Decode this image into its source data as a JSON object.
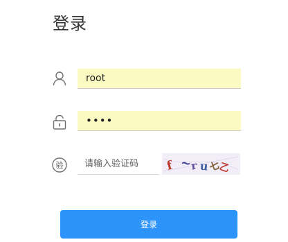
{
  "page": {
    "title": "登录"
  },
  "form": {
    "username": {
      "value": "root",
      "icon": "user-icon"
    },
    "password": {
      "value": "••••",
      "icon": "unlock-icon"
    },
    "captcha": {
      "placeholder": "请输入验证码",
      "icon_label": "验",
      "icon": "captcha-badge-icon",
      "image_glyphs": [
        "f",
        "~",
        "r",
        "u",
        "七",
        "乙"
      ]
    },
    "submit_label": "登录"
  },
  "colors": {
    "accent": "#2c93fb",
    "autofill_background": "#fafac2",
    "icon_stroke": "#707070"
  }
}
